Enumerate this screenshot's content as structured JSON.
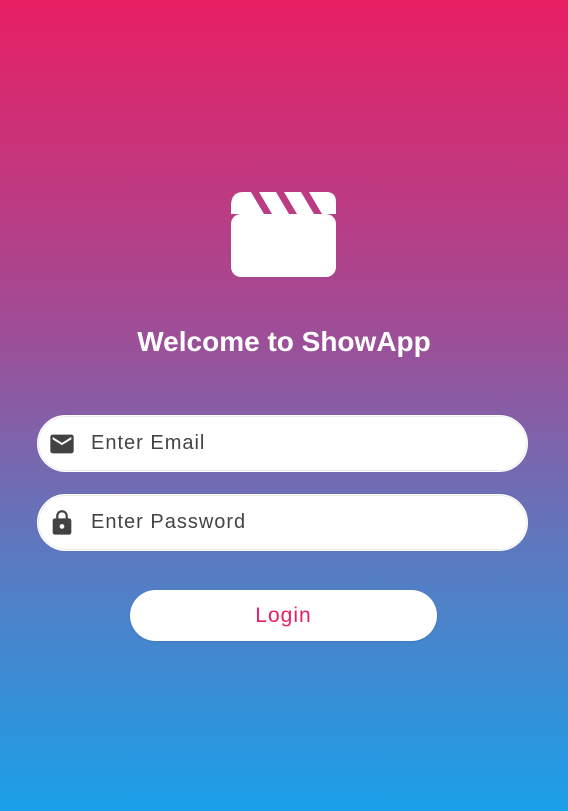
{
  "app": {
    "welcome_text": "Welcome to ShowApp",
    "logo_icon": "movie-clapperboard-icon"
  },
  "form": {
    "email": {
      "placeholder": "Enter Email",
      "value": "",
      "icon": "mail-icon"
    },
    "password": {
      "placeholder": "Enter Password",
      "value": "",
      "icon": "lock-icon"
    },
    "login_label": "Login"
  },
  "colors": {
    "gradient_top": "#e91e63",
    "gradient_bottom": "#1aa0e8",
    "accent": "#e91e63",
    "icon_dark": "#424242"
  }
}
